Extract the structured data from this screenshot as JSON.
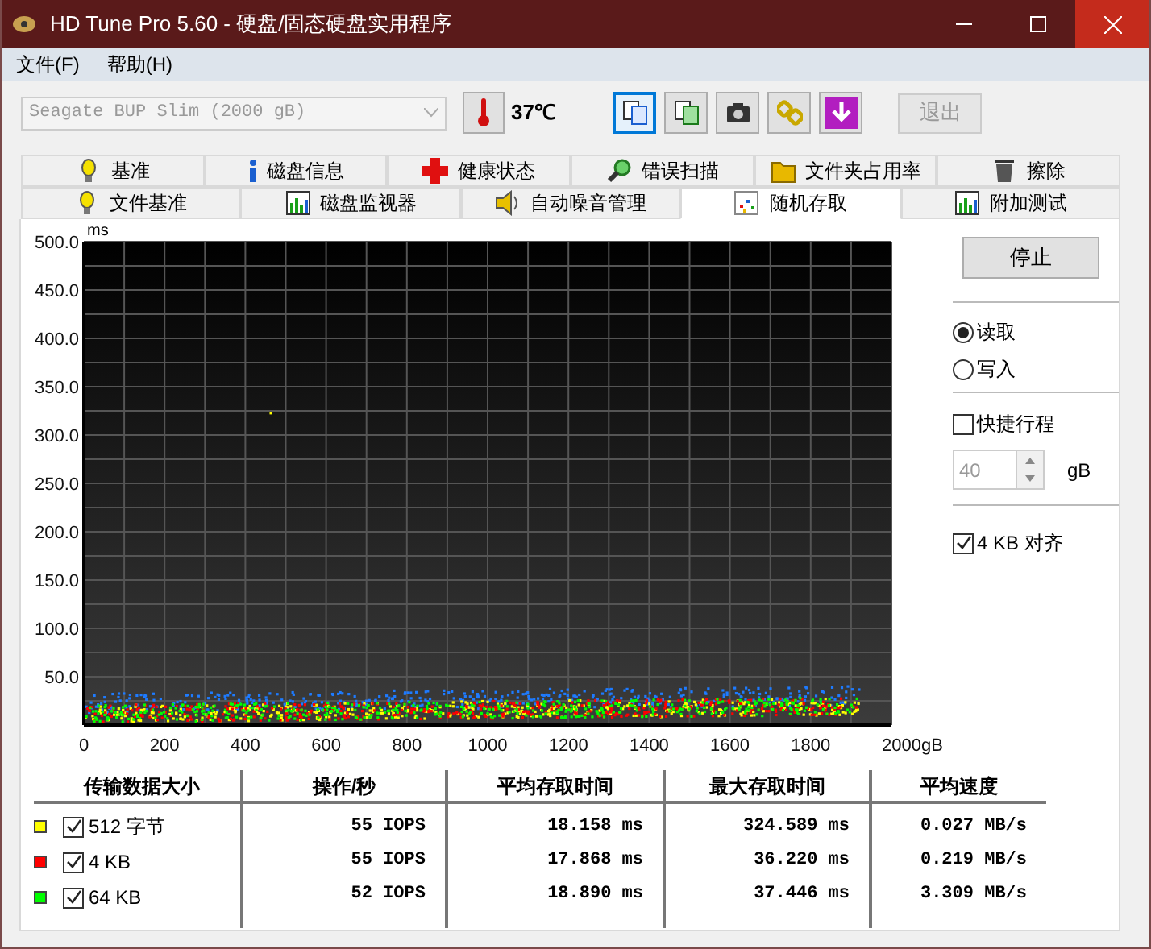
{
  "window": {
    "title": "HD Tune Pro 5.60 - 硬盘/固态硬盘实用程序"
  },
  "menu": [
    "文件(F)",
    "帮助(H)"
  ],
  "toolbar": {
    "drive": "Seagate BUP Slim (2000 gB)",
    "temperature": "37℃",
    "buttons": [
      {
        "kind": "copy",
        "selected": true
      },
      {
        "kind": "copy-all",
        "selected": false
      },
      {
        "kind": "camera",
        "selected": false
      },
      {
        "kind": "chain",
        "selected": false
      },
      {
        "kind": "download",
        "selected": false
      }
    ],
    "exit": {
      "label": "退出",
      "disabled": true
    }
  },
  "tabs": [
    [
      {
        "label": "基准",
        "kind": "bulb",
        "selected": false
      },
      {
        "label": "磁盘信息",
        "kind": "info",
        "selected": false
      },
      {
        "label": "健康状态",
        "kind": "cross",
        "selected": false
      },
      {
        "label": "错误扫描",
        "kind": "search",
        "selected": false
      },
      {
        "label": "文件夹占用率",
        "kind": "folder",
        "selected": false
      },
      {
        "label": "擦除",
        "kind": "trash",
        "selected": false
      }
    ],
    [
      {
        "label": "文件基准",
        "kind": "bulb",
        "selected": false
      },
      {
        "label": "磁盘监视器",
        "kind": "bars",
        "selected": false
      },
      {
        "label": "自动噪音管理",
        "kind": "speaker",
        "selected": false
      },
      {
        "label": "随机存取",
        "kind": "scatter",
        "selected": true
      },
      {
        "label": "附加测试",
        "kind": "bars",
        "selected": false
      }
    ]
  ],
  "chart": {
    "y_unit": "ms",
    "x_unit": "gB",
    "yticks": [
      "500.0",
      "450.0",
      "400.0",
      "350.0",
      "300.0",
      "250.0",
      "200.0",
      "150.0",
      "100.0",
      "50.0"
    ],
    "xticks": [
      "0",
      "200",
      "400",
      "600",
      "800",
      "1000",
      "1200",
      "1400",
      "1600",
      "1800",
      "2000"
    ]
  },
  "side": {
    "stop": "停止",
    "modes": [
      {
        "label": "读取",
        "selected": true
      },
      {
        "label": "写入",
        "selected": false
      }
    ],
    "short_stroke": {
      "label": "快捷行程",
      "checked": false
    },
    "stroke_size": {
      "value": "40",
      "unit": "gB",
      "disabled": true
    },
    "align": {
      "label": "4 KB 对齐",
      "checked": true
    }
  },
  "table": {
    "columns": [
      "传输数据大小",
      "操作/秒",
      "平均存取时间",
      "最大存取时间",
      "平均速度"
    ],
    "rows": [
      {
        "color": "#ffff00",
        "checked": true,
        "size": "512 字节",
        "ops": "55 IOPS",
        "avg": "18.158 ms",
        "max": "324.589 ms",
        "speed": "0.027 MB/s"
      },
      {
        "color": "#ff0000",
        "checked": true,
        "size": "4 KB",
        "ops": "55 IOPS",
        "avg": "17.868 ms",
        "max": "36.220 ms",
        "speed": "0.219 MB/s"
      },
      {
        "color": "#00ff00",
        "checked": true,
        "size": "64 KB",
        "ops": "52 IOPS",
        "avg": "18.890 ms",
        "max": "37.446 ms",
        "speed": "3.309 MB/s"
      }
    ]
  }
}
